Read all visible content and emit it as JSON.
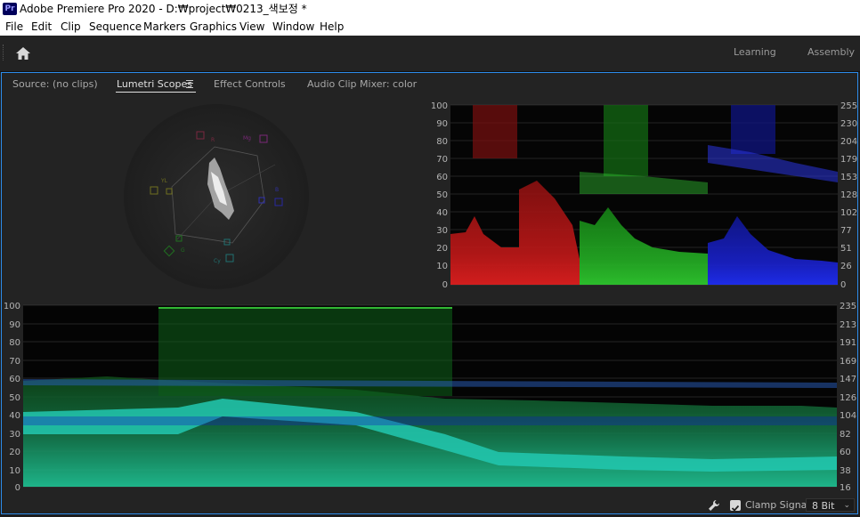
{
  "window": {
    "app_badge": "Pr",
    "title": "Adobe Premiere Pro 2020 - D:₩project₩0213_색보정 *"
  },
  "menu": [
    "File",
    "Edit",
    "Clip",
    "Sequence",
    "Markers",
    "Graphics",
    "View",
    "Window",
    "Help"
  ],
  "workspaces": [
    "Learning",
    "Assembly"
  ],
  "panel_tabs": [
    "Source: (no clips)",
    "Lumetri Scopes",
    "Effect Controls",
    "Audio Clip Mixer: color"
  ],
  "active_tab": "Lumetri Scopes",
  "vectorscope": {
    "targets": [
      "R",
      "Mg",
      "B",
      "Cy",
      "G",
      "YL"
    ]
  },
  "parade": {
    "left_scale": [
      "100",
      "90",
      "80",
      "70",
      "60",
      "50",
      "40",
      "30",
      "20",
      "10",
      "0"
    ],
    "right_scale": [
      "255",
      "230",
      "204",
      "179",
      "153",
      "128",
      "102",
      "77",
      "51",
      "26",
      "0"
    ],
    "channels": [
      "red",
      "green",
      "blue"
    ]
  },
  "waveform": {
    "left_scale": [
      "100",
      "90",
      "80",
      "70",
      "60",
      "50",
      "40",
      "30",
      "20",
      "10",
      "0"
    ],
    "right_scale": [
      "235",
      "213",
      "191",
      "169",
      "147",
      "126",
      "104",
      "82",
      "60",
      "38",
      "16"
    ]
  },
  "footer": {
    "clamp_label": "Clamp Signal",
    "clamp_checked": true,
    "bit_depth": "8 Bit"
  },
  "colors": {
    "accent": "#2d8ceb",
    "red": "#e02020",
    "green": "#30d030",
    "blue": "#2030ff",
    "cyan": "#20c8a0"
  }
}
